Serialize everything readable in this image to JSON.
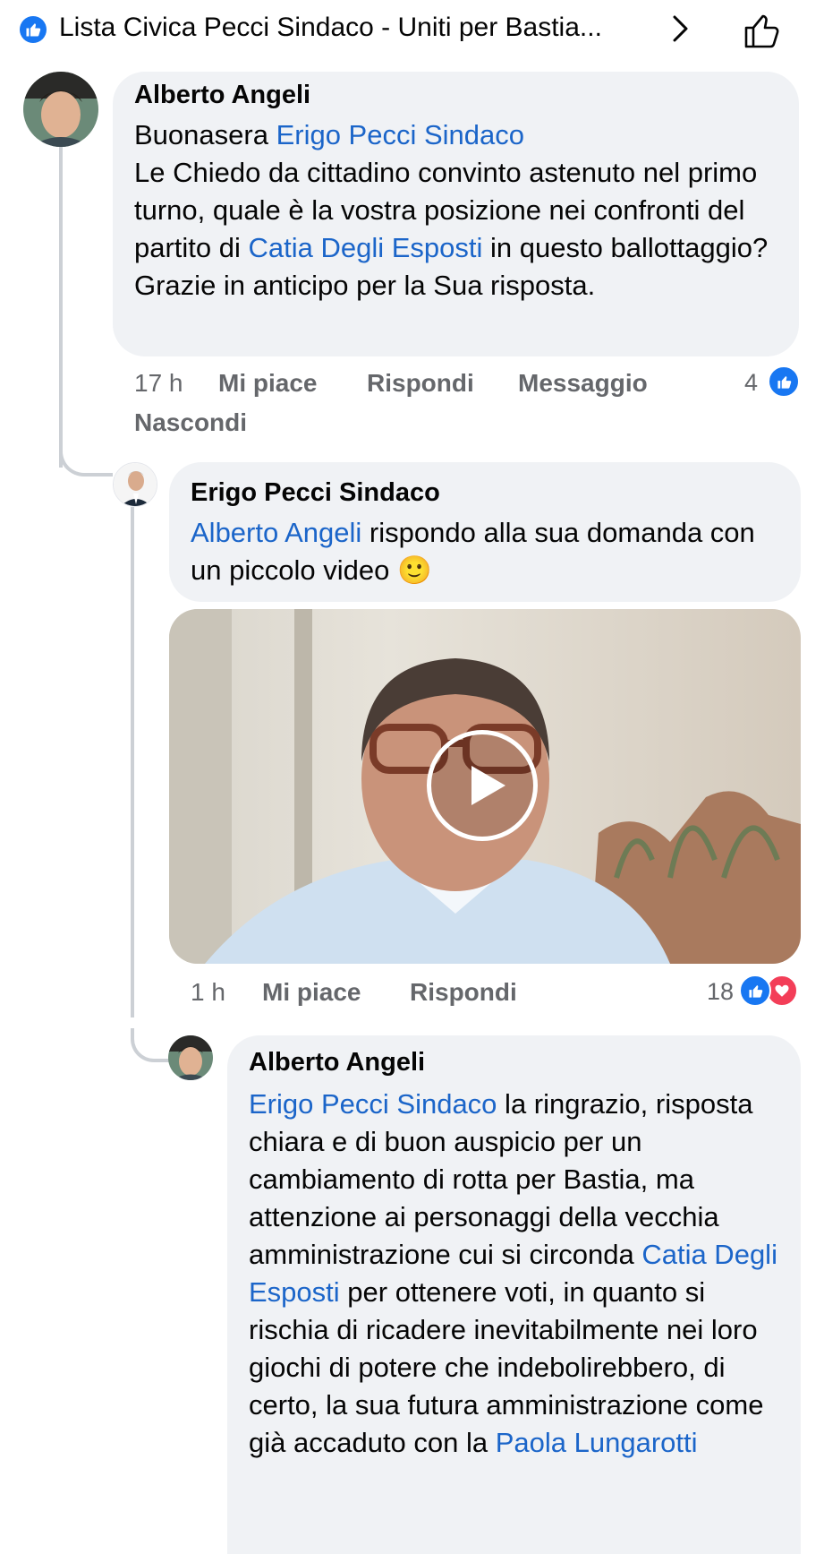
{
  "header": {
    "title": "Lista Civica Pecci Sindaco - Uniti per Bastia..."
  },
  "comments": [
    {
      "author": "Alberto Angeli",
      "text_1_pre": "Buonasera ",
      "text_1_mention": "Erigo Pecci Sindaco",
      "text_2": "Le Chiedo da cittadino convinto astenuto nel primo turno, quale è la vostra posizione nei confronti del partito di ",
      "text_2_mention": "Catia Degli Esposti",
      "text_2_post": " in questo ballottaggio?",
      "text_3": "Grazie in anticipo per la Sua risposta.",
      "time": "17 h",
      "like_label": "Mi piace",
      "reply_label": "Rispondi",
      "message_label": "Messaggio",
      "hide_label": "Nascondi",
      "reaction_count": "4"
    },
    {
      "author": "Erigo Pecci Sindaco",
      "mention": "Alberto Angeli",
      "text": " rispondo alla sua domanda con un piccolo video ",
      "emoji": "🙂",
      "time": "1 h",
      "like_label": "Mi piace",
      "reply_label": "Rispondi",
      "reaction_count": "18"
    },
    {
      "author": "Alberto Angeli",
      "mention_1": "Erigo Pecci Sindaco",
      "text_1": " la ringrazio, risposta chiara e di buon auspicio per un cambiamento di rotta per Bastia, ma attenzione ai personaggi della vecchia amministrazione cui si circonda ",
      "mention_2": "Catia Degli Esposti",
      "text_2": " per ottenere voti, in quanto si rischia di ricadere inevitabilmente nei loro giochi di potere che indebolirebbero, di certo, la sua futura amministrazione come già accaduto con la ",
      "mention_3": "Paola Lungarotti"
    }
  ],
  "colors": {
    "accent_blue": "#1877f2",
    "mention_blue": "#1b65c9",
    "bubble_bg": "#f0f2f5",
    "meta_gray": "#65676b",
    "love_red": "#f33e58"
  }
}
